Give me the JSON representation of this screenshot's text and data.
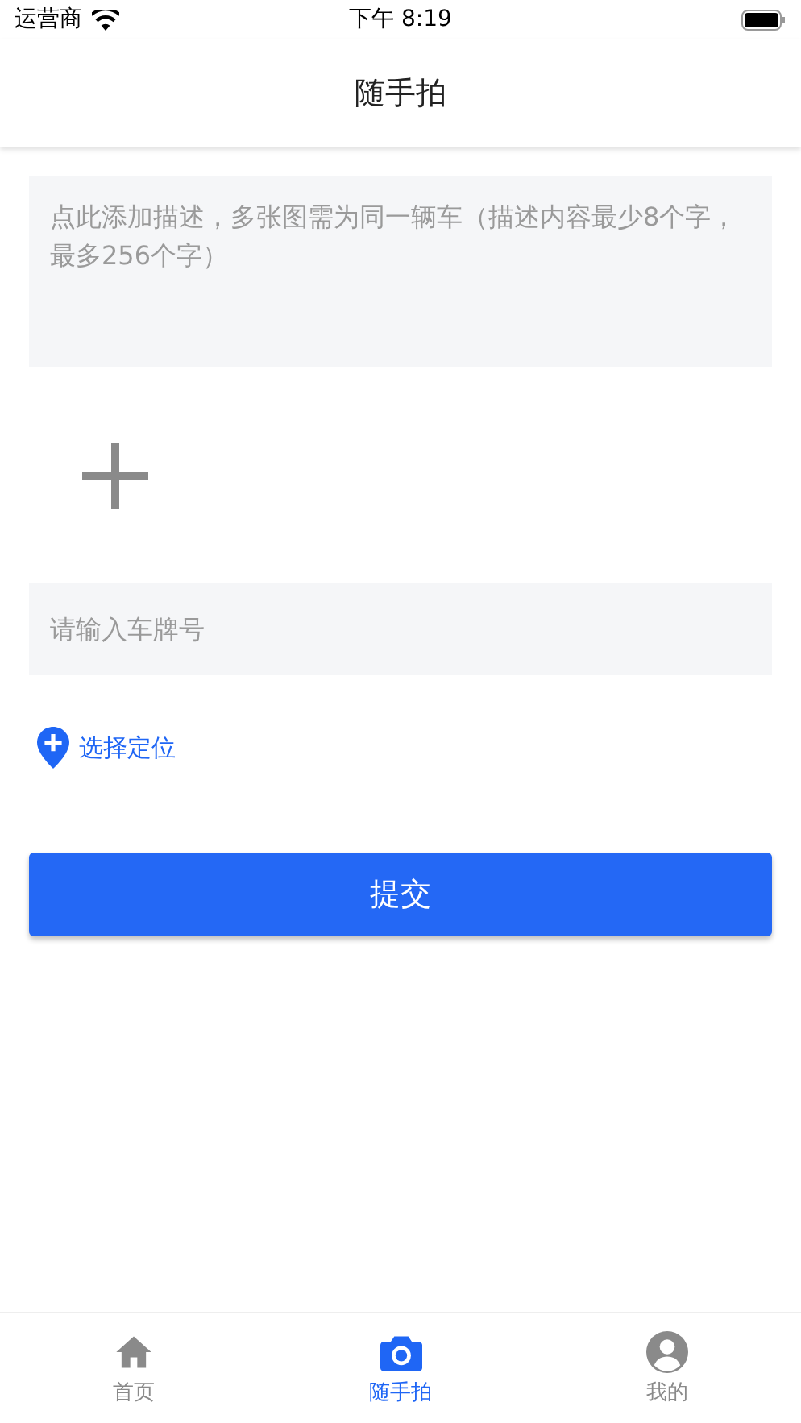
{
  "status_bar": {
    "carrier": "运营商",
    "time": "下午 8:19"
  },
  "nav": {
    "title": "随手拍"
  },
  "description": {
    "placeholder": "点此添加描述，多张图需为同一辆车（描述内容最少8个字，最多256个字）"
  },
  "plate": {
    "placeholder": "请输入车牌号"
  },
  "location": {
    "label": "选择定位"
  },
  "submit": {
    "label": "提交"
  },
  "tabs": [
    {
      "label": "首页",
      "kind": "home",
      "selected": false
    },
    {
      "label": "随手拍",
      "kind": "camera",
      "selected": true
    },
    {
      "label": "我的",
      "kind": "person",
      "selected": false
    }
  ]
}
